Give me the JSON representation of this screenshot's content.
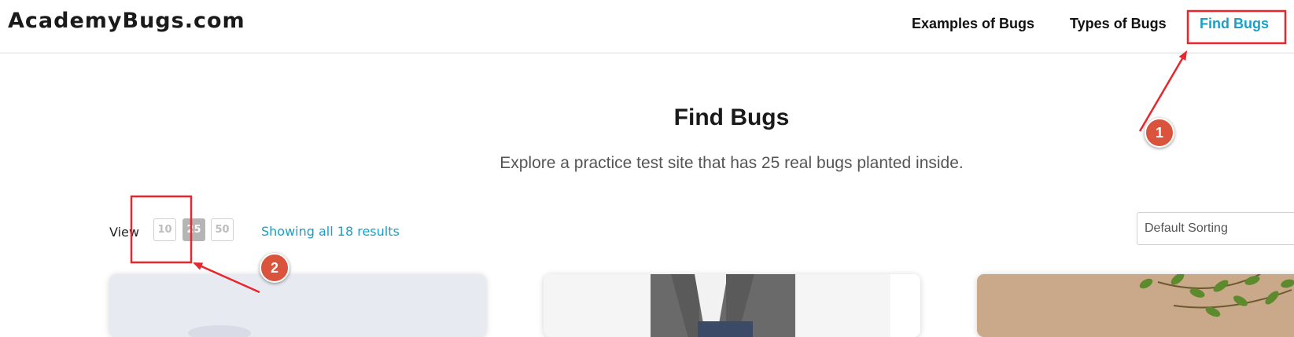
{
  "header": {
    "logo": "AcademyBugs.com",
    "nav": {
      "examples": "Examples of Bugs",
      "types": "Types of Bugs",
      "find": "Find Bugs"
    }
  },
  "hero": {
    "title": "Find Bugs",
    "subtitle": "Explore a practice test site that has 25 real bugs planted inside."
  },
  "toolbar": {
    "view_label": "View",
    "page_sizes": [
      "10",
      "25",
      "50"
    ],
    "selected_page_size": "25",
    "results_text": "Showing all 18 results",
    "sort_value": "Default Sorting"
  },
  "annotations": {
    "badge_1": "1",
    "badge_2": "2",
    "color": "#e8262c"
  },
  "colors": {
    "accent": "#1aa0c8",
    "badge": "#d9533d"
  }
}
